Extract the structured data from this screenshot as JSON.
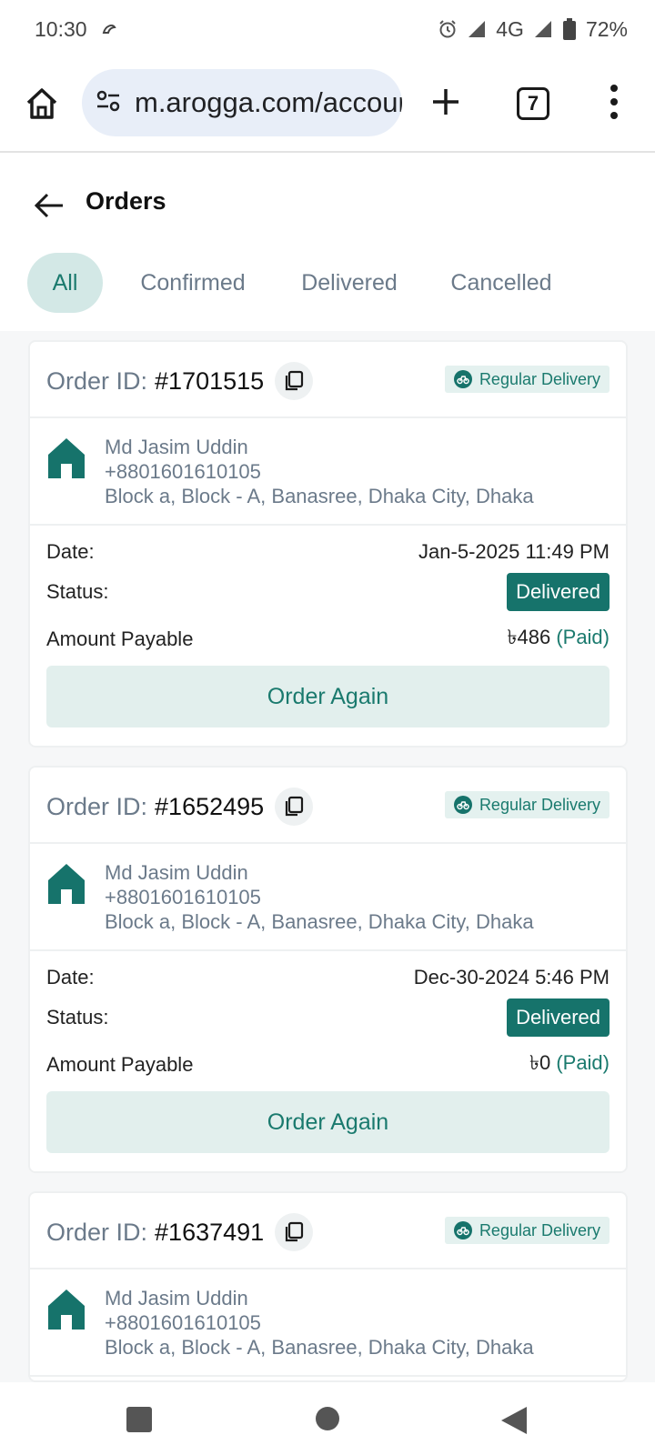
{
  "status_bar": {
    "time": "10:30",
    "network": "4G",
    "battery": "72%"
  },
  "browser": {
    "url": "m.arogga.com/account/orders",
    "tab_count": "7"
  },
  "page": {
    "title": "Orders"
  },
  "filters": [
    {
      "label": "All",
      "active": true
    },
    {
      "label": "Confirmed",
      "active": false
    },
    {
      "label": "Delivered",
      "active": false
    },
    {
      "label": "Cancelled",
      "active": false
    }
  ],
  "labels": {
    "order_id": "Order ID:",
    "date": "Date:",
    "status": "Status:",
    "amount": "Amount Payable",
    "order_again": "Order Again"
  },
  "orders": [
    {
      "id": "#1701515",
      "delivery": "Regular Delivery",
      "name": "Md Jasim Uddin",
      "phone": "+8801601610105",
      "address": "Block a, Block - A, Banasree, Dhaka City, Dhaka",
      "date": "Jan-5-2025 11:49 PM",
      "status": "Delivered",
      "amount": "৳486",
      "payment": "(Paid)"
    },
    {
      "id": "#1652495",
      "delivery": "Regular Delivery",
      "name": "Md Jasim Uddin",
      "phone": "+8801601610105",
      "address": "Block a, Block - A, Banasree, Dhaka City, Dhaka",
      "date": "Dec-30-2024 5:46 PM",
      "status": "Delivered",
      "amount": "৳0",
      "payment": "(Paid)"
    },
    {
      "id": "#1637491",
      "delivery": "Regular Delivery",
      "name": "Md Jasim Uddin",
      "phone": "+8801601610105",
      "address": "Block a, Block - A, Banasree, Dhaka City, Dhaka"
    }
  ],
  "colors": {
    "accent": "#16736b",
    "accent_light": "#e2efed",
    "muted_text": "#6b7a8a"
  }
}
